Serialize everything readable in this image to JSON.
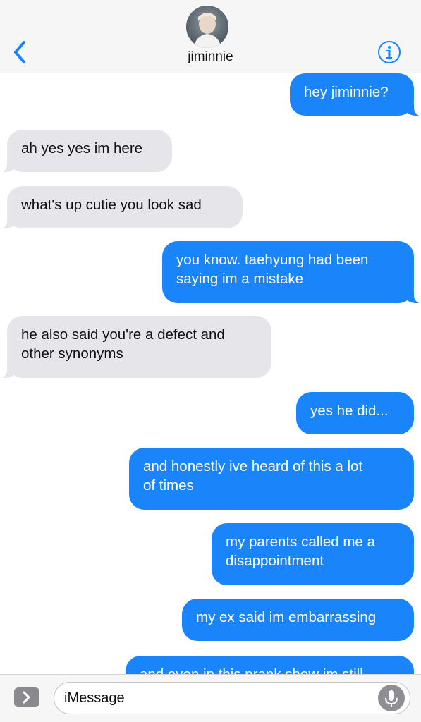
{
  "header": {
    "contact_name": "jiminnie",
    "back_icon": "chevron-left-icon",
    "info_icon": "info-icon",
    "accent_color": "#1a84fb"
  },
  "messages": [
    {
      "side": "sent",
      "lines": [
        "hey jiminnie?"
      ],
      "tail": true
    },
    {
      "side": "received",
      "lines": [
        "ah yes yes im here"
      ],
      "tail": true
    },
    {
      "side": "received",
      "lines": [
        "what's up cutie you look sad"
      ],
      "tail": true
    },
    {
      "side": "sent",
      "lines": [
        "you know. taehyung had been",
        "saying im a mistake"
      ],
      "tail": true
    },
    {
      "side": "received",
      "lines": [
        "he also said you're a defect and",
        "other synonyms"
      ],
      "tail": true
    },
    {
      "side": "sent",
      "lines": [
        "yes he did..."
      ],
      "tail": false
    },
    {
      "side": "sent",
      "lines": [
        "and honestly ive heard of this a lot",
        "of times"
      ],
      "tail": false
    },
    {
      "side": "sent",
      "lines": [
        "my parents called me a",
        "disappointment"
      ],
      "tail": false
    },
    {
      "side": "sent",
      "lines": [
        "my ex said im embarrassing"
      ],
      "tail": false
    },
    {
      "side": "sent",
      "lines": [
        "and even in this prank show im still"
      ],
      "tail": false
    }
  ],
  "input_bar": {
    "placeholder": "iMessage",
    "apps_icon": "chevron-right-icon",
    "mic_icon": "microphone-icon"
  },
  "colors": {
    "sent_bubble": "#1a84fb",
    "received_bubble": "#e6e5ea"
  }
}
